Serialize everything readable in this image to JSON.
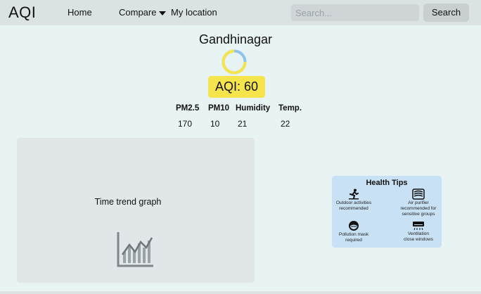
{
  "navbar": {
    "logo": "AQI",
    "items": [
      {
        "label": "Home"
      },
      {
        "label": "Compare"
      },
      {
        "label": "My location"
      }
    ],
    "search": {
      "placeholder": "Search...",
      "value": "",
      "button_label": "Search"
    }
  },
  "city": {
    "name": "Gandhinagar",
    "aqi_label": "AQI: 60",
    "aqi_value": 60,
    "gauge_colors": {
      "primary": "#f6e44c",
      "secondary": "#8fc3ee"
    },
    "badge_color": "#f6e44c"
  },
  "metrics": {
    "headers": [
      "PM2.5",
      "PM10",
      "Humidity",
      "Temp."
    ],
    "values": [
      "170",
      "10",
      "21",
      "22"
    ]
  },
  "graph": {
    "label": "Time trend graph",
    "icon": "chart-icon"
  },
  "health_tips": {
    "title": "Health Tips",
    "items": [
      {
        "icon": "running-icon",
        "lines": [
          "Outdoor activities",
          "recommended"
        ]
      },
      {
        "icon": "air-purifier-icon",
        "lines": [
          "Air purifier",
          "recommended for",
          "sensitive groups"
        ]
      },
      {
        "icon": "mask-icon",
        "lines": [
          "Pollution mask",
          "required"
        ]
      },
      {
        "icon": "air-conditioner-icon",
        "lines": [
          "Ventilation",
          "close windows"
        ]
      }
    ]
  }
}
